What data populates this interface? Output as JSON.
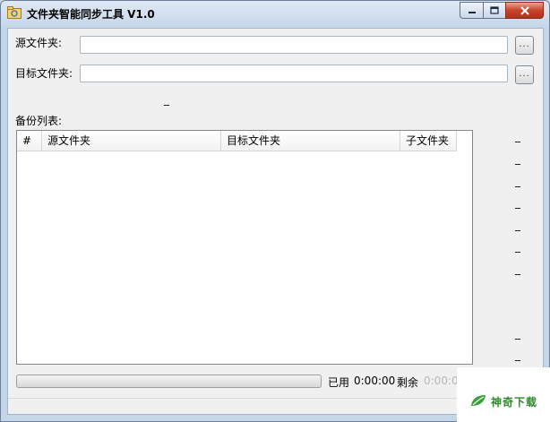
{
  "window": {
    "title": "文件夹智能同步工具 V1.0",
    "icon": "folder-app-icon",
    "controls": [
      "minimize-icon",
      "maximize-icon",
      "close-icon"
    ]
  },
  "form": {
    "source_label": "源文件夹:",
    "source_value": "",
    "target_label": "目标文件夹:",
    "target_value": "",
    "browse_label": "..."
  },
  "backup_list": {
    "label": "备份列表:",
    "columns": [
      "#",
      "源文件夹",
      "目标文件夹",
      "子文件夹"
    ],
    "rows": []
  },
  "status": {
    "progress_percent": 0,
    "elapsed_label": "已用",
    "elapsed_value": "0:00:00",
    "remaining_label": "剩余",
    "remaining_value": "0:00:00"
  },
  "watermark": {
    "text": "神奇下载"
  },
  "colors": {
    "remaining_value": "#b8b8b8",
    "watermark": "#2f8a2c"
  }
}
